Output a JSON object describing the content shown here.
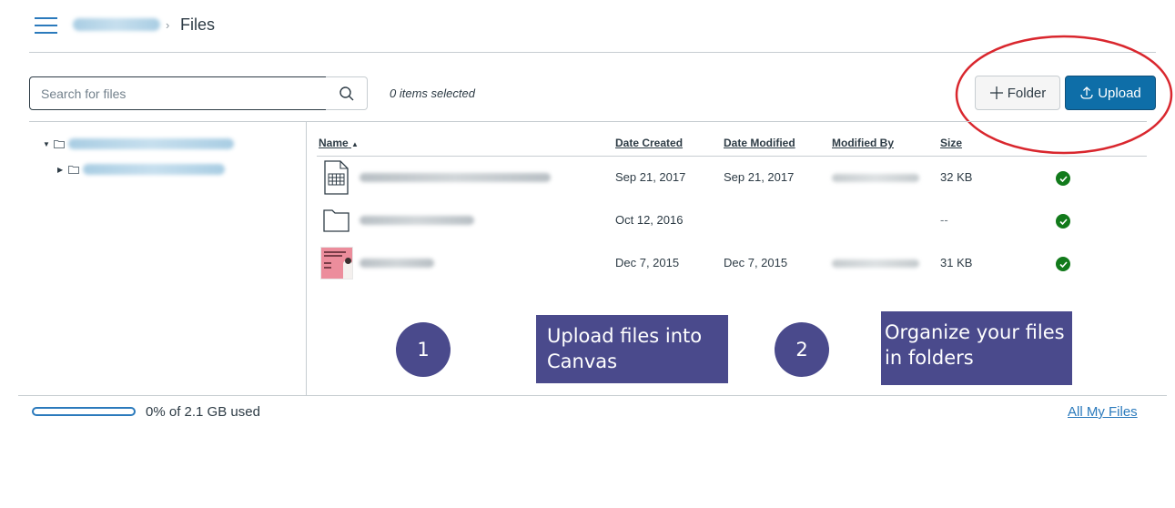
{
  "header": {
    "menu_icon": "hamburger-menu-icon",
    "breadcrumb": {
      "course": "[redacted course name]",
      "separator": "›",
      "current": "Files"
    }
  },
  "toolbar": {
    "search_placeholder": "Search for files",
    "search_value": "",
    "search_icon": "search-icon",
    "selected_count": "0 items selected",
    "folder_button": "Folder",
    "folder_icon": "plus-icon",
    "upload_button": "Upload",
    "upload_icon": "upload-icon"
  },
  "tree": {
    "items": [
      {
        "label": "[redacted course files]",
        "expanded": true,
        "level": 0
      },
      {
        "label": "[redacted folder]",
        "expanded": false,
        "level": 1
      }
    ]
  },
  "table": {
    "columns": {
      "name": "Name",
      "sort_indicator": "▲",
      "date_created": "Date Created",
      "date_modified": "Date Modified",
      "modified_by": "Modified By",
      "size": "Size"
    },
    "rows": [
      {
        "icon": "spreadsheet-file-icon",
        "name": "[redacted .xlsx]",
        "date_created": "Sep 21, 2017",
        "date_modified": "Sep 21, 2017",
        "modified_by": "[redacted]",
        "size": "32 KB",
        "status": "published"
      },
      {
        "icon": "folder-icon",
        "name": "[redacted folder]",
        "date_created": "Oct 12, 2016",
        "date_modified": "",
        "modified_by": "",
        "size": "--",
        "status": "published"
      },
      {
        "icon": "image-thumbnail",
        "name": "[redacted .jpg]",
        "date_created": "Dec 7, 2015",
        "date_modified": "Dec 7, 2015",
        "modified_by": "[redacted]",
        "size": "31 KB",
        "status": "published"
      }
    ]
  },
  "annotations": {
    "step1_number": "1",
    "step1_text": "Upload files into Canvas",
    "step2_number": "2",
    "step2_text": "Organize your files in folders",
    "highlight_color": "#d9272e",
    "callout_color": "#4a4a8c"
  },
  "footer": {
    "quota_percent": 0,
    "quota_text": "0% of 2.1 GB used",
    "all_files_link": "All My Files"
  },
  "colors": {
    "brand": "#0e6ea8",
    "link": "#2b7abc",
    "published": "#127a1b"
  }
}
